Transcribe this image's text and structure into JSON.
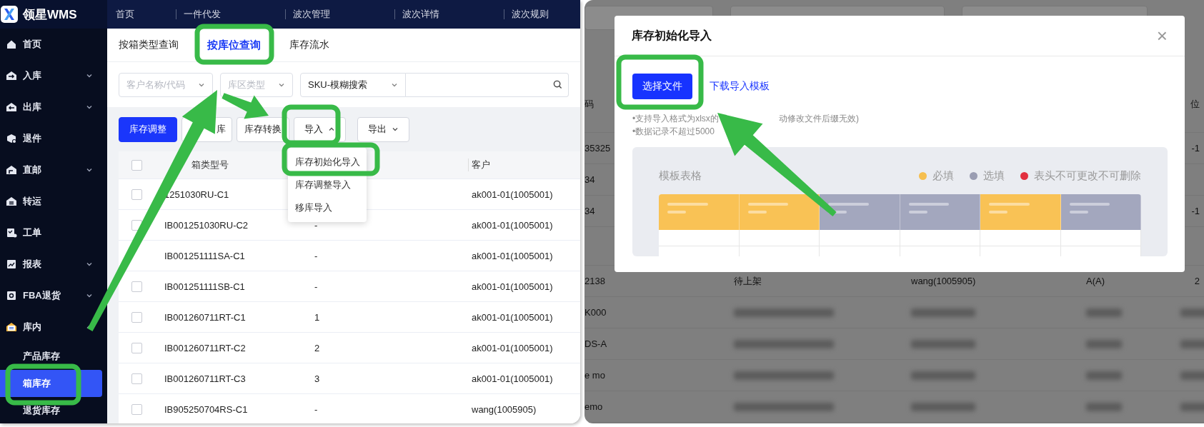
{
  "left_screen": {
    "logo": "领星WMS",
    "top_nav": [
      "首页",
      "一件代发",
      "波次管理",
      "波次详情",
      "波次规则"
    ],
    "sidebar": [
      {
        "label": "首页"
      },
      {
        "label": "入库",
        "expanded": false
      },
      {
        "label": "出库",
        "expanded": false
      },
      {
        "label": "退件"
      },
      {
        "label": "直邮",
        "expanded": false
      },
      {
        "label": "转运"
      },
      {
        "label": "工单"
      },
      {
        "label": "报表",
        "expanded": false
      },
      {
        "label": "FBA退货",
        "expanded": false
      },
      {
        "label": "库内",
        "expanded": true,
        "children": [
          {
            "label": "产品库存",
            "selected": false
          },
          {
            "label": "箱库存",
            "selected": true
          },
          {
            "label": "退货库存",
            "selected": false
          }
        ]
      }
    ],
    "tabs": [
      {
        "label": "按箱类型查询",
        "selected": false
      },
      {
        "label": "按库位查询",
        "selected": true
      },
      {
        "label": "库存流水",
        "selected": false
      }
    ],
    "filters": [
      {
        "placeholder": "客户名称/代码"
      },
      {
        "placeholder": "库区类型"
      }
    ],
    "search": {
      "mode": "SKU-模糊搜索"
    },
    "actions": [
      {
        "label": "库存调整",
        "kind": "primary"
      },
      {
        "label": "库",
        "kind": "plain"
      },
      {
        "label": "库存转换",
        "kind": "plain"
      },
      {
        "label": "导入",
        "kind": "dropdown",
        "expanded": true
      },
      {
        "label": "导出",
        "kind": "dropdown",
        "expanded": false
      }
    ],
    "import_menu": [
      "库存初始化导入",
      "库存调整导入",
      "移库导入"
    ],
    "table": {
      "all_checked": false,
      "columns": {
        "column_1": "箱类型号",
        "column_3": "客户"
      },
      "rows": [
        {
          "checked": false,
          "cells": {
            "column_1": "1251030RU-C1",
            "column_3": "ak001-01(1005001)"
          }
        },
        {
          "checked": false,
          "cells": {
            "column_1": "IB001251030RU-C2",
            "column_2": "-",
            "column_3": "ak001-01(1005001)"
          }
        },
        {
          "cells": {
            "column_1": "IB001251111SA-C1",
            "column_2": "-",
            "column_3": "ak001-01(1005001)"
          }
        },
        {
          "checked": false,
          "cells": {
            "column_1": "IB001251111SB-C1",
            "column_2": "-",
            "column_3": "ak001-01(1005001)"
          }
        },
        {
          "checked": false,
          "cells": {
            "column_1": "IB001260711RT-C1",
            "column_2": "1",
            "column_3": "ak001-01(1005001)"
          }
        },
        {
          "checked": false,
          "cells": {
            "column_1": "IB001260711RT-C2",
            "column_2": "2",
            "column_3": "ak001-01(1005001)"
          }
        },
        {
          "checked": false,
          "cells": {
            "column_1": "IB001260711RT-C3",
            "column_2": "3",
            "column_3": "ak001-01(1005001)"
          }
        },
        {
          "checked": false,
          "cells": {
            "column_1": "IB905250704RS-C1",
            "column_2": "-",
            "column_3": "wang(1005905)"
          }
        }
      ]
    }
  },
  "right_screen": {
    "background_table": {
      "columns": {
        "column_1": "码",
        "column_5": "位"
      },
      "rows": [
        {
          "blurred": false,
          "cells": {
            "column_1": "35325",
            "column_5": "-1"
          }
        },
        {
          "blurred": false,
          "cells": {
            "column_1": "34"
          }
        },
        {
          "blurred": false,
          "cells": {
            "column_1": "34",
            "column_5": "-1"
          }
        },
        {
          "blurred": false,
          "cells": {}
        },
        {
          "blurred": false,
          "cells": {
            "column_1": "2138",
            "column_2": "待上架",
            "column_3": "wang(1005905)",
            "column_4": "A(A)",
            "column_5": "2"
          }
        },
        {
          "blurred": true,
          "cells": {
            "column_1": "K000"
          }
        },
        {
          "blurred": true,
          "cells": {
            "column_1": "DS-A"
          }
        },
        {
          "blurred": true,
          "cells": {
            "column_1": "e mo"
          }
        },
        {
          "blurred": true,
          "cells": {
            "column_1": "emo"
          }
        }
      ]
    },
    "modal": {
      "title": "库存初始化导入",
      "close": "×",
      "choose_file": "选择文件",
      "template_link": "下载导入模板",
      "notes": [
        {
          "parts": [
            "•支持导入格式为xlsx的",
            "动修改文件后缀无效)"
          ]
        },
        {
          "parts": [
            "•数据记录不超过5000"
          ]
        }
      ],
      "template": {
        "title": "模板表格",
        "legend": [
          {
            "label": "必填",
            "color": "#f6bf4f"
          },
          {
            "label": "选填",
            "color": "#9a9db2"
          },
          {
            "label": "表头不可更改不可删除",
            "color": "#e2303f"
          }
        ],
        "columns": [
          {
            "kind": "required"
          },
          {
            "kind": "required"
          },
          {
            "kind": "optional"
          },
          {
            "kind": "optional"
          },
          {
            "kind": "required"
          },
          {
            "kind": "optional"
          }
        ]
      }
    }
  }
}
